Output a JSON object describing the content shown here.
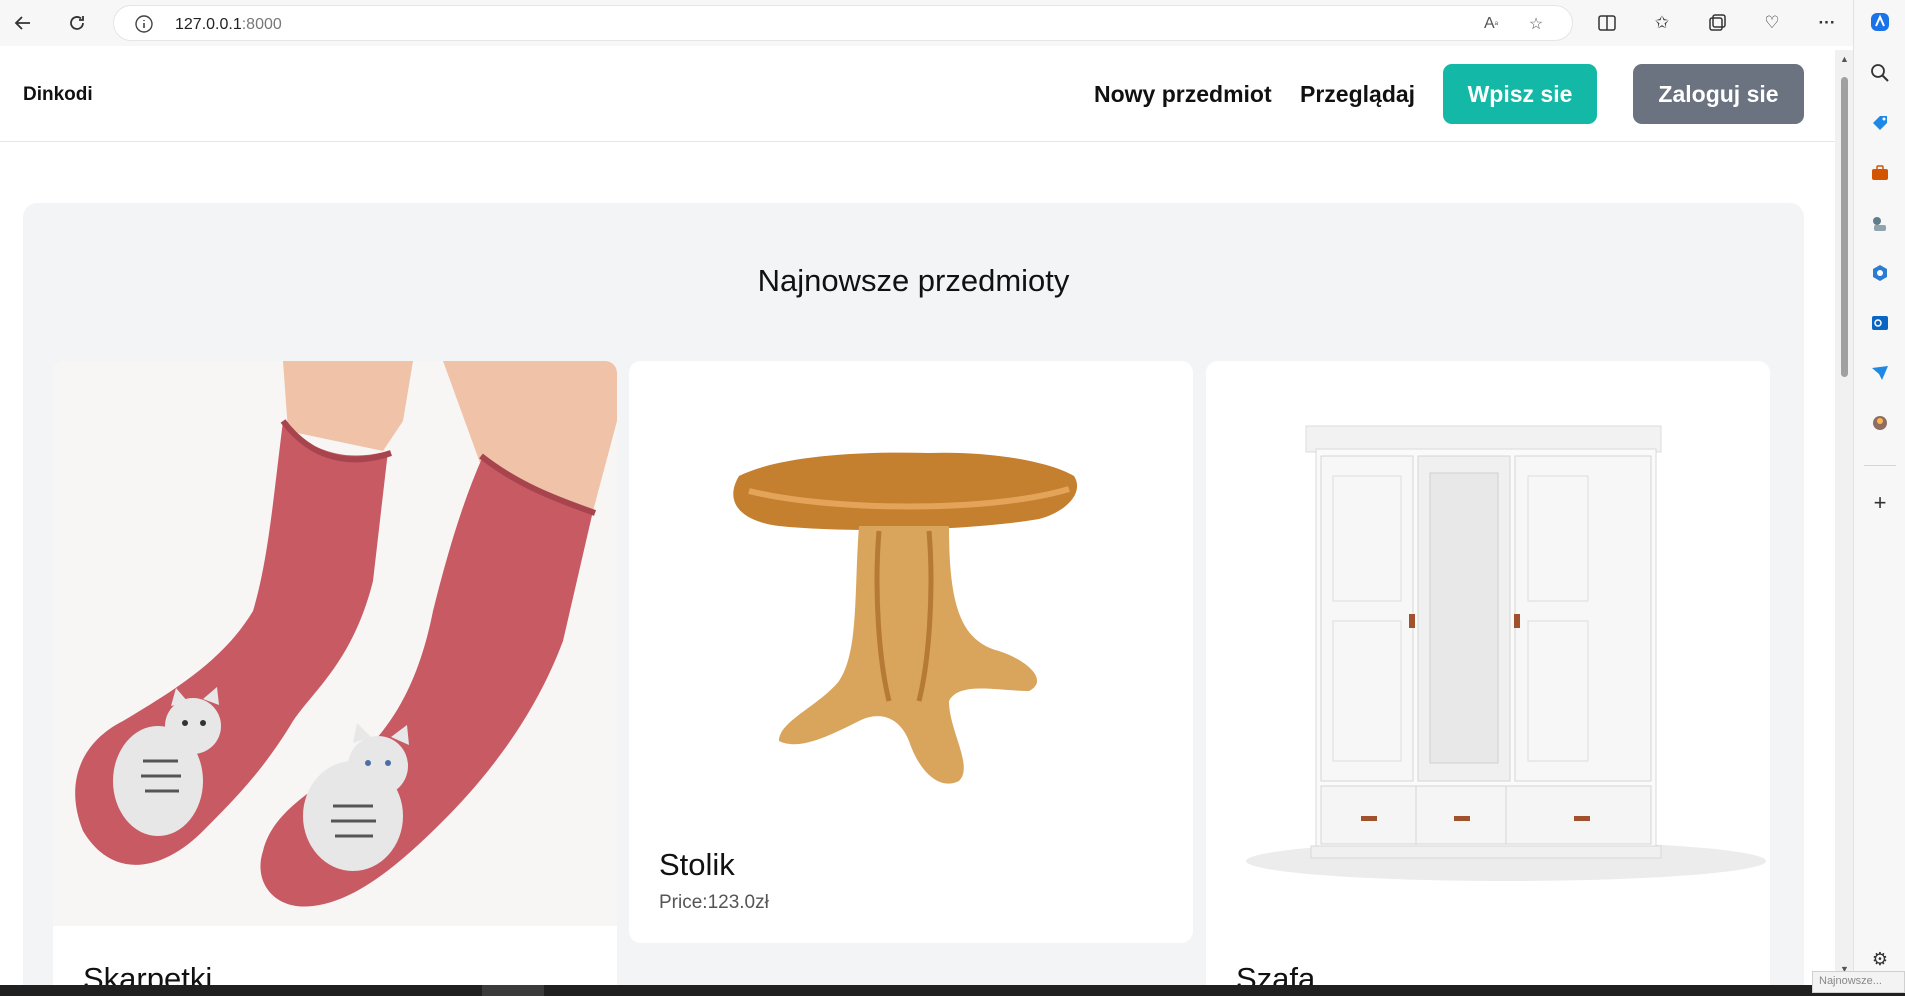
{
  "browser": {
    "url_host": "127.0.0.1",
    "url_port": ":8000"
  },
  "nav": {
    "brand": "Dinkodi",
    "links": [
      "Nowy przedmiot",
      "Przeglądaj"
    ],
    "signup_label": "Wpisz sie",
    "login_label": "Zaloguj sie"
  },
  "section": {
    "title": "Najnowsze przedmioty"
  },
  "items": [
    {
      "name": "Skarpetki",
      "price": ""
    },
    {
      "name": "Stolik",
      "price": "Price:123.0zł"
    },
    {
      "name": "Szafa",
      "price": ""
    }
  ],
  "colors": {
    "accent": "#14b8a6",
    "secondary": "#6b7280",
    "panel_bg": "#f3f4f6"
  },
  "taskbar": {
    "notification_text": "Najnowsze..."
  }
}
